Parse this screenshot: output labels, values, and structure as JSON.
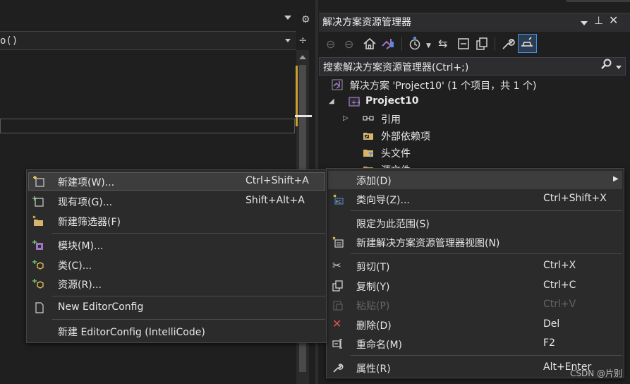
{
  "editor": {
    "member_text": "o()"
  },
  "solution_explorer": {
    "title": "解决方案资源管理器",
    "search_placeholder": "搜索解决方案资源管理器(Ctrl+;)",
    "toolbar_icons": [
      "back-icon",
      "forward-icon",
      "home-icon",
      "vs-switch-views-icon",
      "pending-changes-filter-icon",
      "sync-icon",
      "collapse-all-icon",
      "show-all-files-icon",
      "properties-wrench-icon",
      "preview-selected-icon"
    ],
    "tree": {
      "solution": "解决方案 'Project10' (1 个项目，共 1 个)",
      "project": "Project10",
      "references": "引用",
      "external_deps": "外部依赖项",
      "header_files": "头文件",
      "source_files_partial": "源文件"
    }
  },
  "context_menu": {
    "items": [
      {
        "label": "添加(D)",
        "shortcut": "",
        "submenu": true
      },
      {
        "label": "类向导(Z)...",
        "shortcut": "Ctrl+Shift+X"
      },
      {
        "label": "限定为此范围(S)",
        "shortcut": ""
      },
      {
        "label": "新建解决方案资源管理器视图(N)",
        "shortcut": ""
      },
      {
        "label": "剪切(T)",
        "shortcut": "Ctrl+X"
      },
      {
        "label": "复制(Y)",
        "shortcut": "Ctrl+C"
      },
      {
        "label": "粘贴(P)",
        "shortcut": "Ctrl+V",
        "disabled": true
      },
      {
        "label": "删除(D)",
        "shortcut": "Del"
      },
      {
        "label": "重命名(M)",
        "shortcut": "F2"
      },
      {
        "label": "属性(R)",
        "shortcut": "Alt+Enter"
      }
    ]
  },
  "add_submenu": {
    "items": [
      {
        "label": "新建项(W)...",
        "shortcut": "Ctrl+Shift+A"
      },
      {
        "label": "现有项(G)...",
        "shortcut": "Shift+Alt+A"
      },
      {
        "label": "新建筛选器(F)",
        "shortcut": ""
      },
      {
        "label": "模块(M)...",
        "shortcut": ""
      },
      {
        "label": "类(C)...",
        "shortcut": ""
      },
      {
        "label": "资源(R)...",
        "shortcut": ""
      },
      {
        "label": "New EditorConfig",
        "shortcut": ""
      },
      {
        "label": "新建 EditorConfig (IntelliCode)",
        "shortcut": ""
      }
    ]
  },
  "watermark": "CSDN @片别",
  "colors": {
    "background": "#1f1f1f",
    "menu_bg": "#2b2b2b",
    "highlight": "#3d3d3d",
    "accent_blue": "#3f94e6",
    "vs_purple": "#a074c4",
    "red_delete": "#e05252"
  }
}
